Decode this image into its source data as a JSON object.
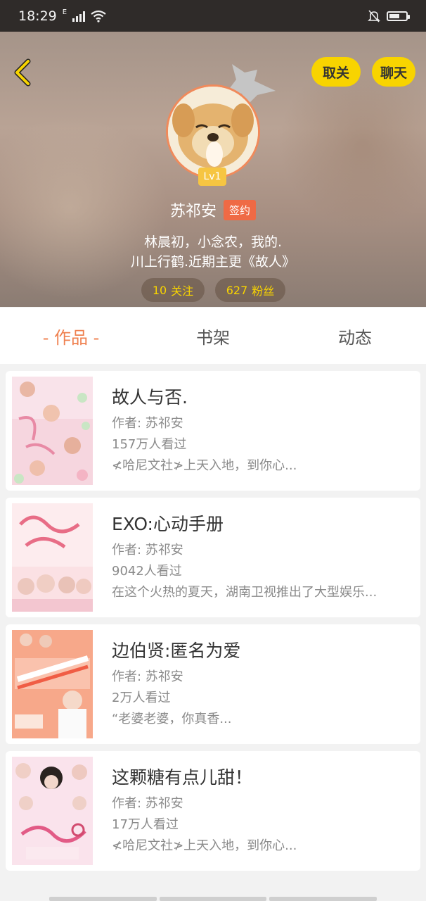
{
  "status_bar": {
    "time": "18:29",
    "network": "E",
    "icons": [
      "signal-icon",
      "wifi-icon",
      "mute-bell-icon",
      "battery-icon"
    ]
  },
  "header": {
    "unfollow_label": "取关",
    "chat_label": "聊天",
    "level": "Lv1",
    "username": "苏祁安",
    "badge": "签约",
    "bio_line1": "林晨初，小念农，我的.",
    "bio_line2": "川上行鹤.近期主更《故人》",
    "follows_count": "10",
    "follows_label": "关注",
    "fans_count": "627",
    "fans_label": "粉丝"
  },
  "tabs": [
    {
      "label": "- 作品 -",
      "active": true
    },
    {
      "label": "书架",
      "active": false
    },
    {
      "label": "动态",
      "active": false
    }
  ],
  "works": [
    {
      "title": "故人与否.",
      "author": "作者: 苏祁安",
      "views": "157万人看过",
      "summary": "≮哈尼文社≯上天入地，到你心..."
    },
    {
      "title": "EXO:心动手册",
      "author": "作者: 苏祁安",
      "views": "9042人看过",
      "summary": "在这个火热的夏天，湖南卫视推出了大型娱乐..."
    },
    {
      "title": "边伯贤:匿名为爱",
      "author": "作者: 苏祁安",
      "views": "2万人看过",
      "summary": "“老婆老婆，你真香..."
    },
    {
      "title": "这颗糖有点儿甜！",
      "author": "作者: 苏祁安",
      "views": "17万人看过",
      "summary": "≮哈尼文社≯上天入地，到你心..."
    }
  ],
  "colors": {
    "accent": "#ef8150",
    "yellow": "#f8d400",
    "badge": "#ef6a45",
    "status_bar": "#2f2b29"
  }
}
